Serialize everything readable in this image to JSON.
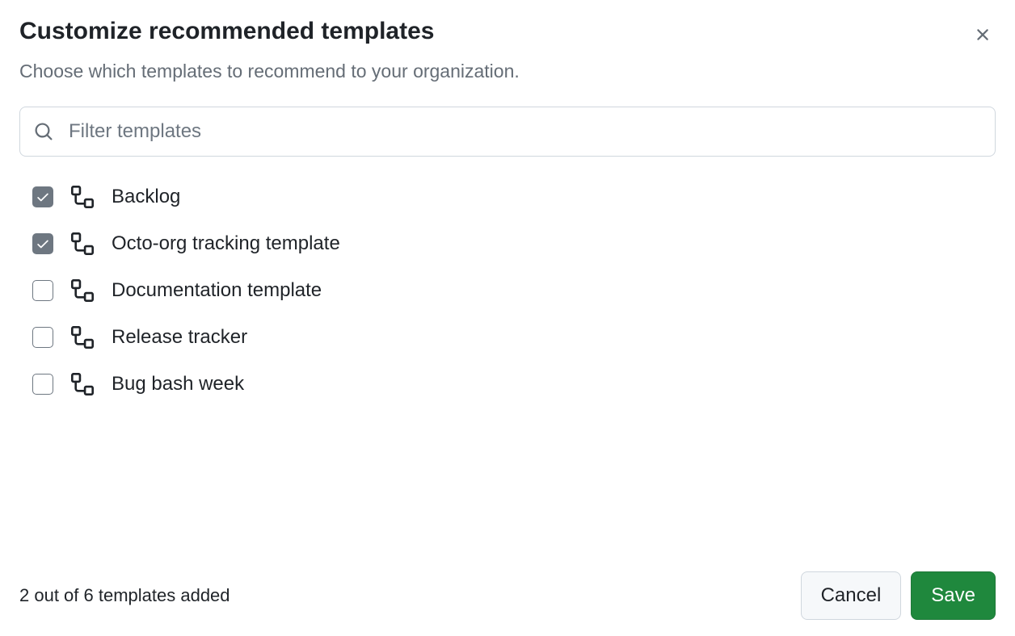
{
  "dialog": {
    "title": "Customize recommended templates",
    "subtitle": "Choose which templates to recommend to your organization."
  },
  "search": {
    "placeholder": "Filter templates",
    "value": ""
  },
  "templates": [
    {
      "label": "Backlog",
      "checked": true
    },
    {
      "label": "Octo-org tracking template",
      "checked": true
    },
    {
      "label": "Documentation template",
      "checked": false
    },
    {
      "label": "Release tracker",
      "checked": false
    },
    {
      "label": "Bug bash week",
      "checked": false
    }
  ],
  "footer": {
    "status": "2 out of 6 templates added",
    "cancel_label": "Cancel",
    "save_label": "Save"
  }
}
